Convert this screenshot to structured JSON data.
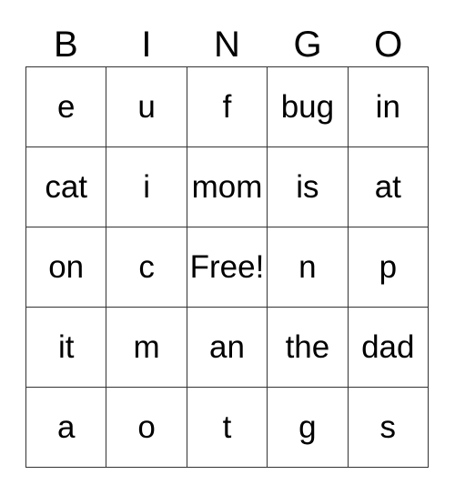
{
  "card": {
    "type": "bingo-card",
    "header_letters": [
      "B",
      "I",
      "N",
      "G",
      "O"
    ],
    "grid_size": "5x5",
    "free_space_label": "Free!",
    "colors": {
      "background": "#ffffff",
      "text": "#000000",
      "grid_line": "#333333"
    },
    "rows": [
      {
        "cells": [
          "e",
          "u",
          "f",
          "bug",
          "in"
        ]
      },
      {
        "cells": [
          "cat",
          "i",
          "mom",
          "is",
          "at"
        ]
      },
      {
        "cells": [
          "on",
          "c",
          "Free!",
          "n",
          "p"
        ]
      },
      {
        "cells": [
          "it",
          "m",
          "an",
          "the",
          "dad"
        ]
      },
      {
        "cells": [
          "a",
          "o",
          "t",
          "g",
          "s"
        ]
      }
    ]
  }
}
